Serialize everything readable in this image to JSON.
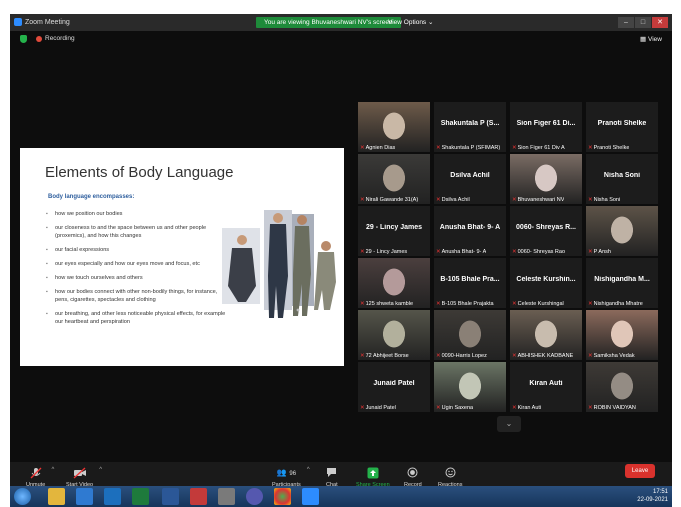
{
  "titlebar": {
    "app_title": "Zoom Meeting",
    "viewing_banner": "You are viewing Bhuvaneshwari NV's screen",
    "view_options": "View Options ⌄"
  },
  "status": {
    "recording": "Recording",
    "view": "View"
  },
  "slide": {
    "title": "Elements of Body Language",
    "subtitle": "Body language encompasses:",
    "bullets": [
      "how we position our bodies",
      "our closeness to and the space between us and other people (proxemics), and how this changes",
      "our facial expressions",
      "our eyes especially and how our eyes move and focus, etc",
      "how we touch ourselves and others",
      "how our bodies connect with other non-bodily things, for instance, pens, cigarettes, spectacles and clothing",
      "our breathing, and other less noticeable physical effects, for example our heartbeat and perspiration"
    ]
  },
  "gallery": [
    {
      "name": "",
      "label": "Agnien Dias",
      "type": "video",
      "colors": [
        "#6e5b4a",
        "#c9b8a6"
      ]
    },
    {
      "name": "Shakuntala P (S...",
      "label": "Shakuntala P (SFIMAR)",
      "type": "name"
    },
    {
      "name": "Sion Figer 61 Di...",
      "label": "Sion Figer 61 Div A",
      "type": "name"
    },
    {
      "name": "Pranoti Shelke",
      "label": "Pranoti Shelke",
      "type": "name"
    },
    {
      "name": "",
      "label": "Nirali Gawande 31(A)",
      "type": "video",
      "colors": [
        "#3b3a38",
        "#a79a8c"
      ]
    },
    {
      "name": "Dsilva Achil",
      "label": "Dsilva Achil",
      "type": "name"
    },
    {
      "name": "",
      "label": "Bhuvaneshwari NV",
      "type": "video",
      "colors": [
        "#7a6c64",
        "#d7c8c4"
      ]
    },
    {
      "name": "Nisha Soni",
      "label": "Nisha Soni",
      "type": "name"
    },
    {
      "name": "29 - Lincy James",
      "label": "29 - Lincy James",
      "type": "name"
    },
    {
      "name": "Anusha Bhat- 9- A",
      "label": "Anusha Bhat- 9- A",
      "type": "name"
    },
    {
      "name": "0060- Shreyas R...",
      "label": "0060- Shreyas Rao",
      "type": "name"
    },
    {
      "name": "",
      "label": "P Ansh",
      "type": "video",
      "colors": [
        "#5d5348",
        "#bfb2a5"
      ]
    },
    {
      "name": "",
      "label": "125 shweta kamble",
      "type": "video",
      "colors": [
        "#4b3f3e",
        "#b49a9a"
      ]
    },
    {
      "name": "B-105 Bhale Pra...",
      "label": "B-105 Bhale Prajakta",
      "type": "name"
    },
    {
      "name": "Celeste Kurshin...",
      "label": "Celeste Kurshingal",
      "type": "name"
    },
    {
      "name": "Nishigandha M...",
      "label": "Nishigandha Mhatre",
      "type": "name"
    },
    {
      "name": "",
      "label": "72 Abhijeet Borse",
      "type": "video",
      "colors": [
        "#55554a",
        "#b2b09c"
      ],
      "active": true
    },
    {
      "name": "",
      "label": "0090-Harris Lopez",
      "type": "video",
      "colors": [
        "#3d3a36",
        "#8a8076"
      ]
    },
    {
      "name": "",
      "label": "ABHISHEK KADBANE",
      "type": "video",
      "colors": [
        "#6a5e52",
        "#c8bcae"
      ]
    },
    {
      "name": "",
      "label": "Samiksha Vedak",
      "type": "video",
      "colors": [
        "#8b6a5c",
        "#e0c6b8"
      ]
    },
    {
      "name": "Junaid Patel",
      "label": "Junaid Patel",
      "type": "name"
    },
    {
      "name": "",
      "label": "Ugin Saxena",
      "type": "video",
      "colors": [
        "#6b7565",
        "#c2c6b6"
      ]
    },
    {
      "name": "Kiran Auti",
      "label": "Kiran Auti",
      "type": "name"
    },
    {
      "name": "",
      "label": "ROBIN VAIDYAN",
      "type": "video",
      "colors": [
        "#3e3a36",
        "#948c84"
      ]
    }
  ],
  "toolbar": {
    "unmute": "Unmute",
    "start_video": "Start Video",
    "participants": "Participants",
    "participants_count": "96",
    "chat": "Chat",
    "share_screen": "Share Screen",
    "record": "Record",
    "reactions": "Reactions",
    "leave": "Leave"
  },
  "tray": {
    "time": "17:51",
    "date": "22-09-2021"
  },
  "colors": {
    "banner_green": "#1e8b3a",
    "leave_red": "#d9322d",
    "active_speaker": "#b9d13f",
    "share_green": "#24b24b"
  }
}
